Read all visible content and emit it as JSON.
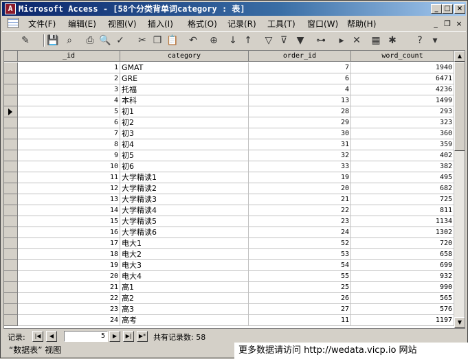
{
  "window": {
    "title": "Microsoft Access - [58个分类背单词category : 表]",
    "min": "_",
    "max": "□",
    "close": "×",
    "doc_min": "_",
    "doc_restore": "❐",
    "doc_close": "×"
  },
  "menu": [
    "文件(F)",
    "编辑(E)",
    "视图(V)",
    "插入(I)",
    "格式(O)",
    "记录(R)",
    "工具(T)",
    "窗口(W)",
    "帮助(H)"
  ],
  "columns": [
    "_id",
    "category",
    "order_id",
    "word_count"
  ],
  "rows": [
    [
      "1",
      "GMAT",
      "7",
      "1940"
    ],
    [
      "2",
      "GRE",
      "6",
      "6471"
    ],
    [
      "3",
      "托福",
      "4",
      "4236"
    ],
    [
      "4",
      "本科",
      "13",
      "1499"
    ],
    [
      "5",
      "初1",
      "28",
      "293"
    ],
    [
      "6",
      "初2",
      "29",
      "323"
    ],
    [
      "7",
      "初3",
      "30",
      "360"
    ],
    [
      "8",
      "初4",
      "31",
      "359"
    ],
    [
      "9",
      "初5",
      "32",
      "402"
    ],
    [
      "10",
      "初6",
      "33",
      "382"
    ],
    [
      "11",
      "大学精读1",
      "19",
      "495"
    ],
    [
      "12",
      "大学精读2",
      "20",
      "682"
    ],
    [
      "13",
      "大学精读3",
      "21",
      "725"
    ],
    [
      "14",
      "大学精读4",
      "22",
      "811"
    ],
    [
      "15",
      "大学精读5",
      "23",
      "1134"
    ],
    [
      "16",
      "大学精读6",
      "24",
      "1302"
    ],
    [
      "17",
      "电大1",
      "52",
      "720"
    ],
    [
      "18",
      "电大2",
      "53",
      "658"
    ],
    [
      "19",
      "电大3",
      "54",
      "699"
    ],
    [
      "20",
      "电大4",
      "55",
      "932"
    ],
    [
      "21",
      "高1",
      "25",
      "990"
    ],
    [
      "22",
      "高2",
      "26",
      "565"
    ],
    [
      "23",
      "高3",
      "27",
      "576"
    ],
    [
      "24",
      "高考",
      "11",
      "1197"
    ]
  ],
  "current_row": 5,
  "record_nav": {
    "label": "记录:",
    "current": "5",
    "total_label": "共有记录数: 58"
  },
  "status": {
    "view": "“数据表” 视图"
  },
  "watermark": "更多数据请访问 http://wedata.vicp.io 网站"
}
